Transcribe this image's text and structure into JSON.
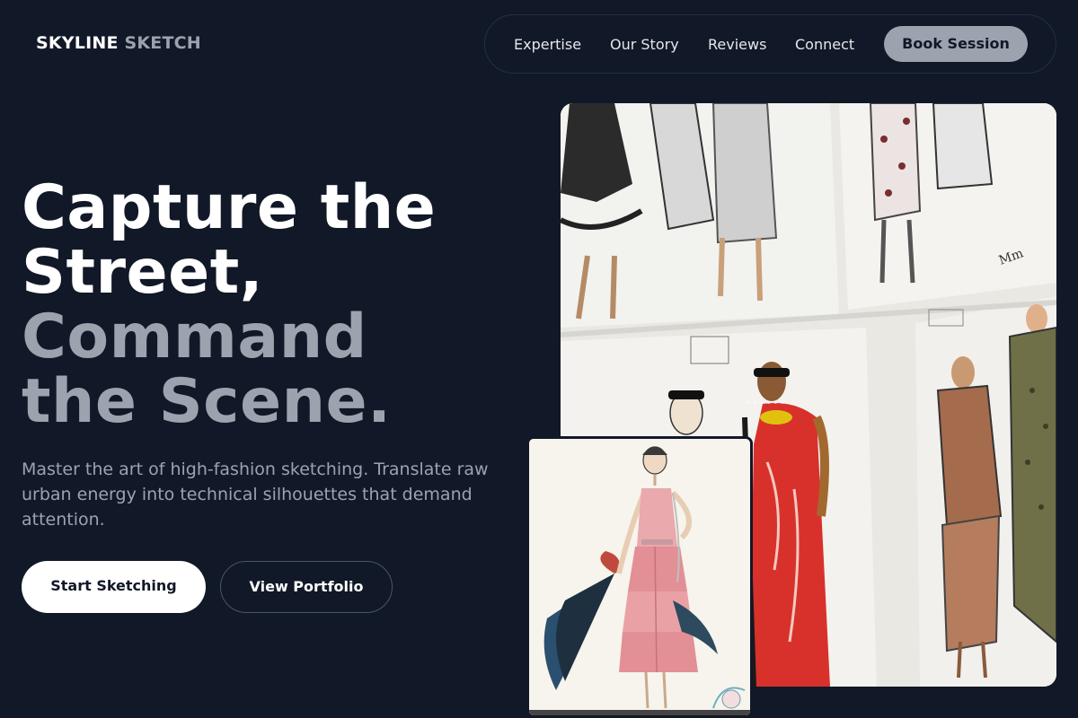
{
  "header": {
    "logo_primary": "SKYLINE",
    "logo_secondary": "SKETCH",
    "nav": [
      "Expertise",
      "Our Story",
      "Reviews",
      "Connect"
    ],
    "cta": "Book Session"
  },
  "hero": {
    "headline_line1": "Capture the",
    "headline_line2": "Street,",
    "headline_line3": "Command",
    "headline_line4": "the Scene.",
    "subtext": "Master the art of high-fashion sketching. Translate raw urban energy into technical silhouettes that demand attention.",
    "primary_button": "Start Sketching",
    "secondary_button": "View Portfolio"
  },
  "colors": {
    "background": "#111827",
    "accent_muted": "#9ca3af",
    "primary_text": "#ffffff"
  }
}
